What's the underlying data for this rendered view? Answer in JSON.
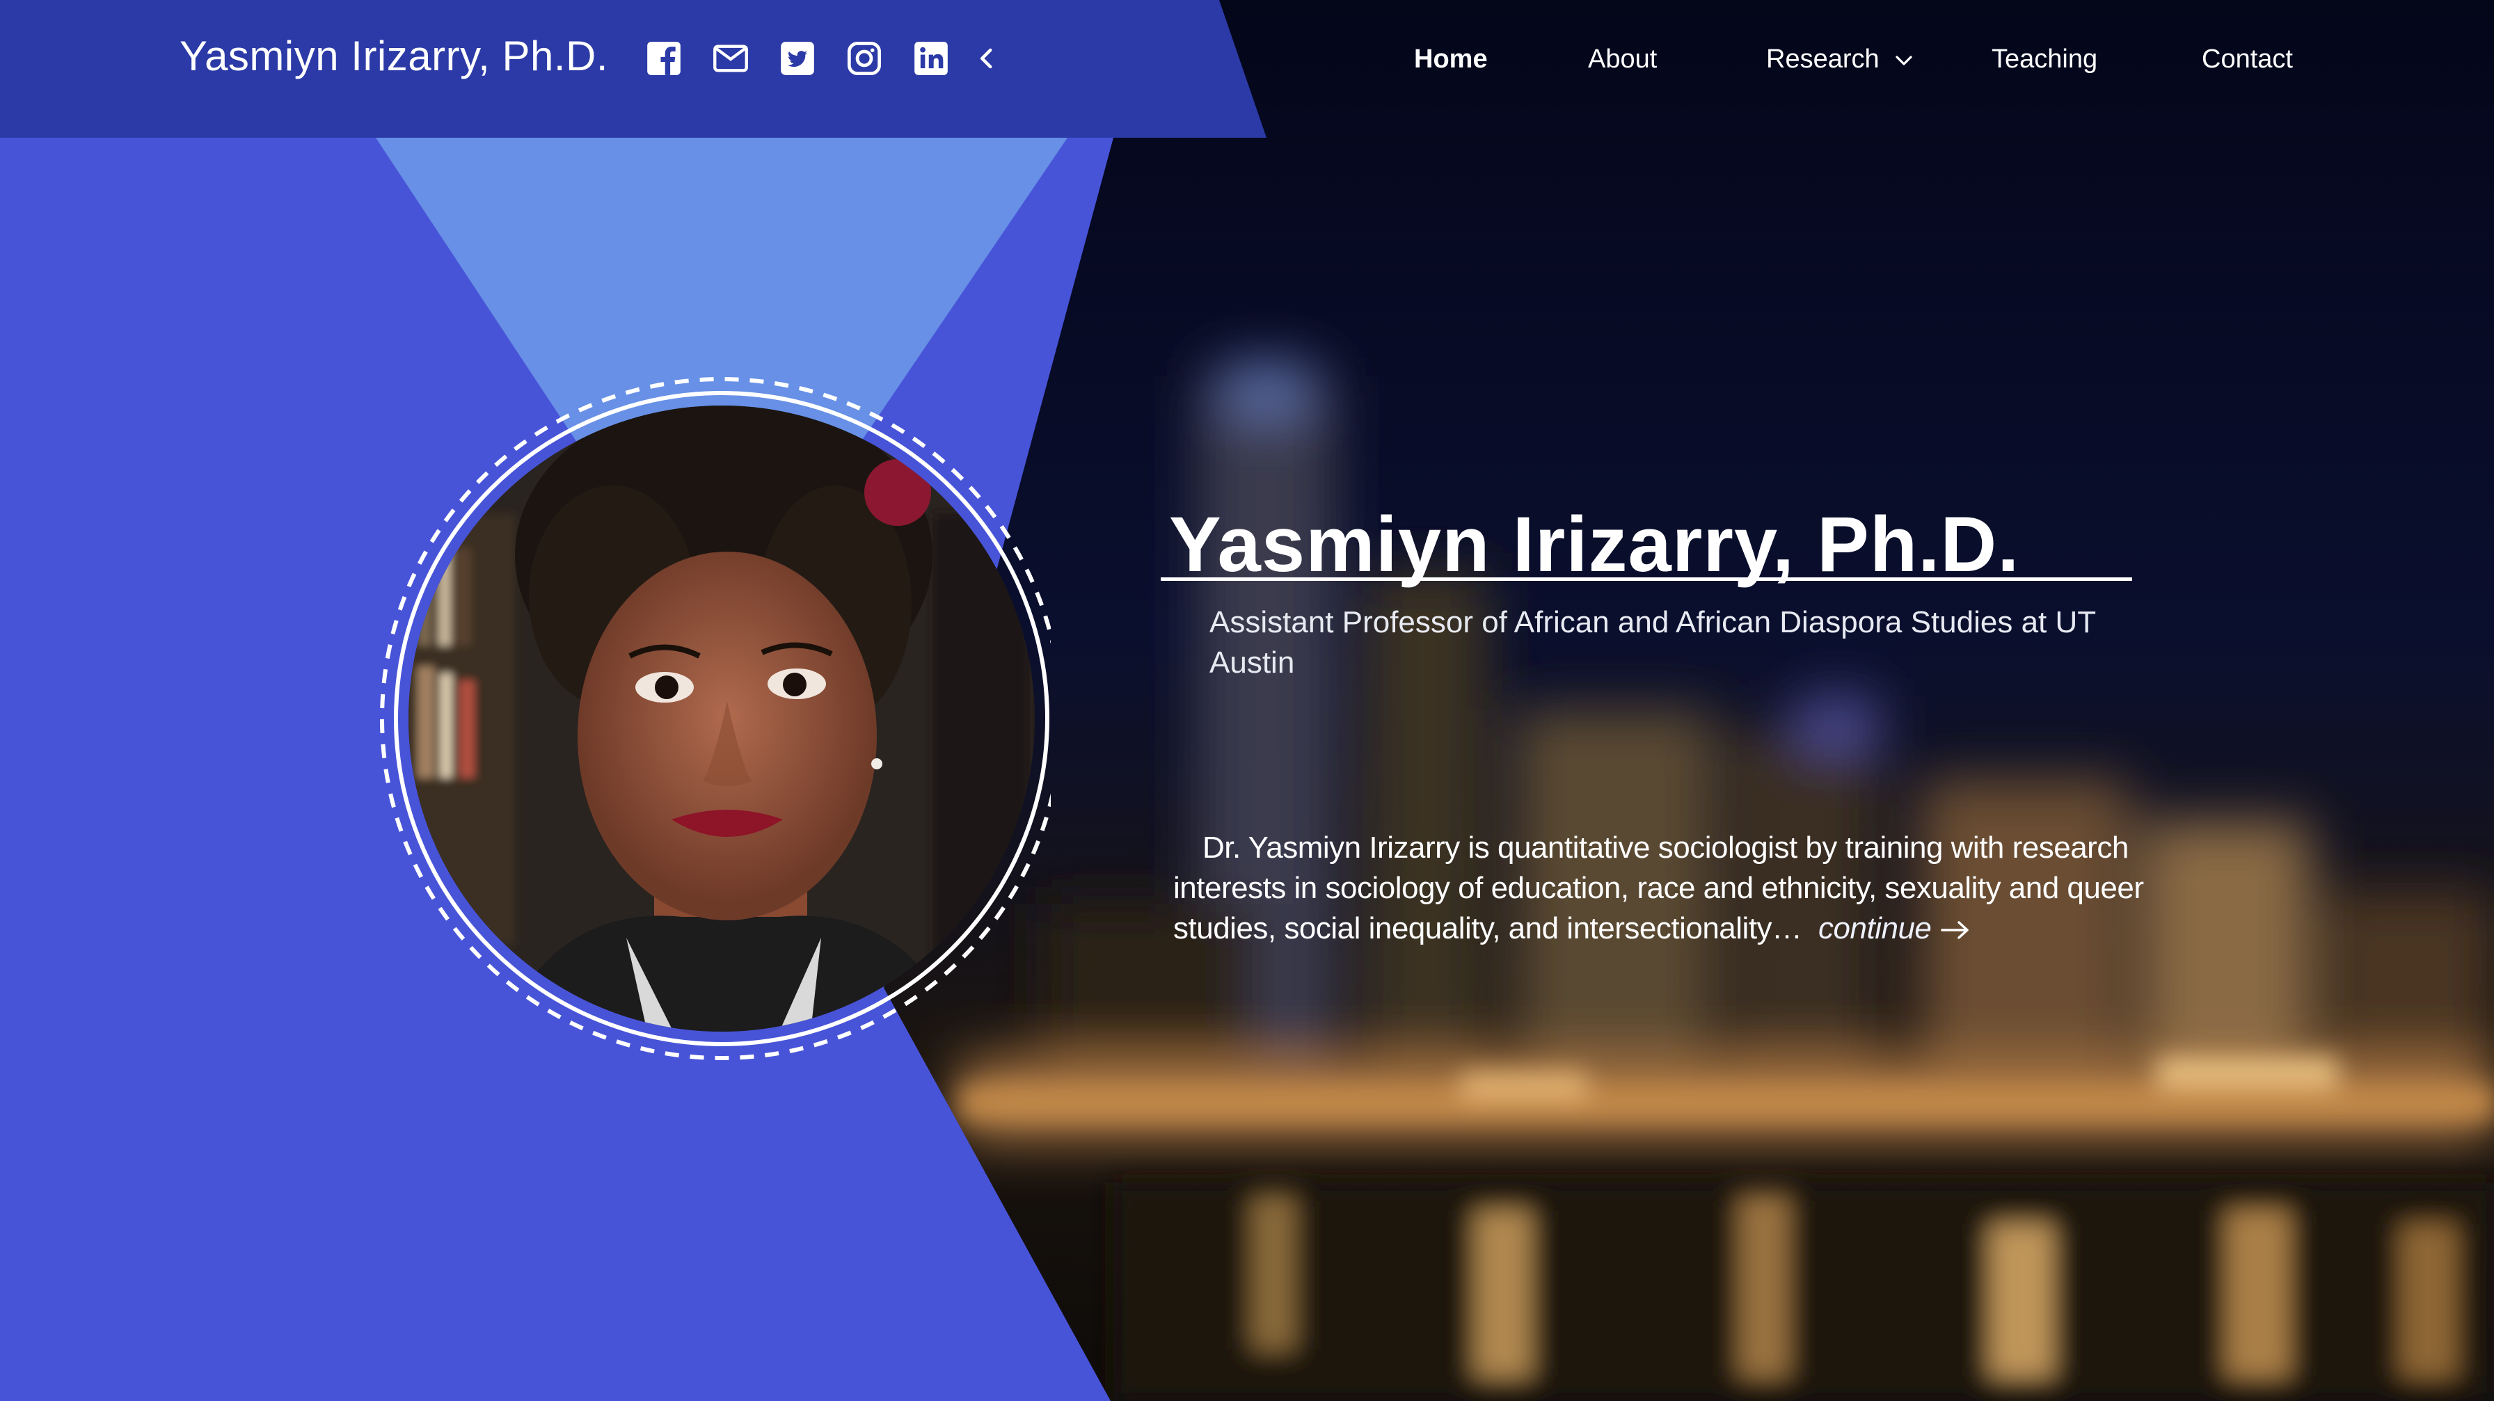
{
  "header": {
    "brand": "Yasmiyn Irizarry, Ph.D.",
    "socials": [
      {
        "icon": "facebook-icon"
      },
      {
        "icon": "mail-icon"
      },
      {
        "icon": "twitter-icon"
      },
      {
        "icon": "instagram-icon"
      },
      {
        "icon": "linkedin-icon"
      },
      {
        "icon": "chevron-left-icon"
      }
    ]
  },
  "nav": {
    "items": [
      {
        "label": "Home",
        "active": true
      },
      {
        "label": "About"
      },
      {
        "label": "Research",
        "has_dropdown": true
      },
      {
        "label": "Teaching"
      },
      {
        "label": "Contact"
      }
    ]
  },
  "hero": {
    "title": "Yasmiyn Irizarry, Ph.D.",
    "subtitle": "Assistant Professor of African and African Diaspora Studies at UT Austin",
    "bio": "Dr. Yasmiyn Irizarry is quantitative sociologist by training with research interests in sociology of education, race and ethnicity, sexuality and queer studies, social inequality, and intersectionality…",
    "continue_label": "continue"
  },
  "colors": {
    "header_bar": "#2b3aa6",
    "panel_blue": "#4854d8",
    "panel_light": "#6790e6",
    "text": "#ffffff"
  }
}
